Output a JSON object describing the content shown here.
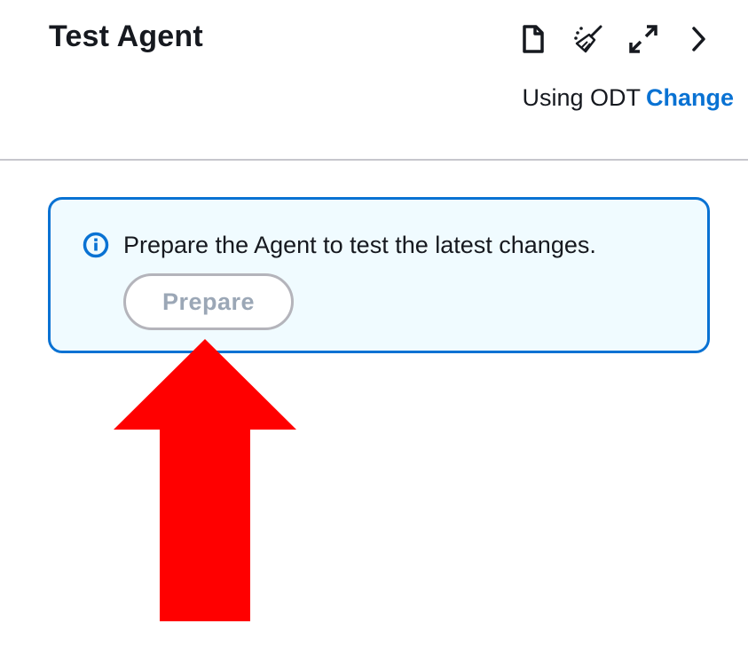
{
  "panel": {
    "title": "Test Agent",
    "toolbar": {
      "icons": [
        "file-icon",
        "broom-icon",
        "expand-icon",
        "chevron-right-icon"
      ]
    },
    "odt": {
      "text": "Using ODT",
      "link_label": "Change"
    }
  },
  "alert": {
    "icon": "info-icon",
    "message": "Prepare the Agent to test the latest changes.",
    "button_label": "Prepare"
  },
  "annotation": {
    "arrow_color": "#ff0000"
  },
  "colors": {
    "accent": "#0972d3",
    "alert_bg": "#f0fbff",
    "disabled_text": "#9ba7b6"
  }
}
